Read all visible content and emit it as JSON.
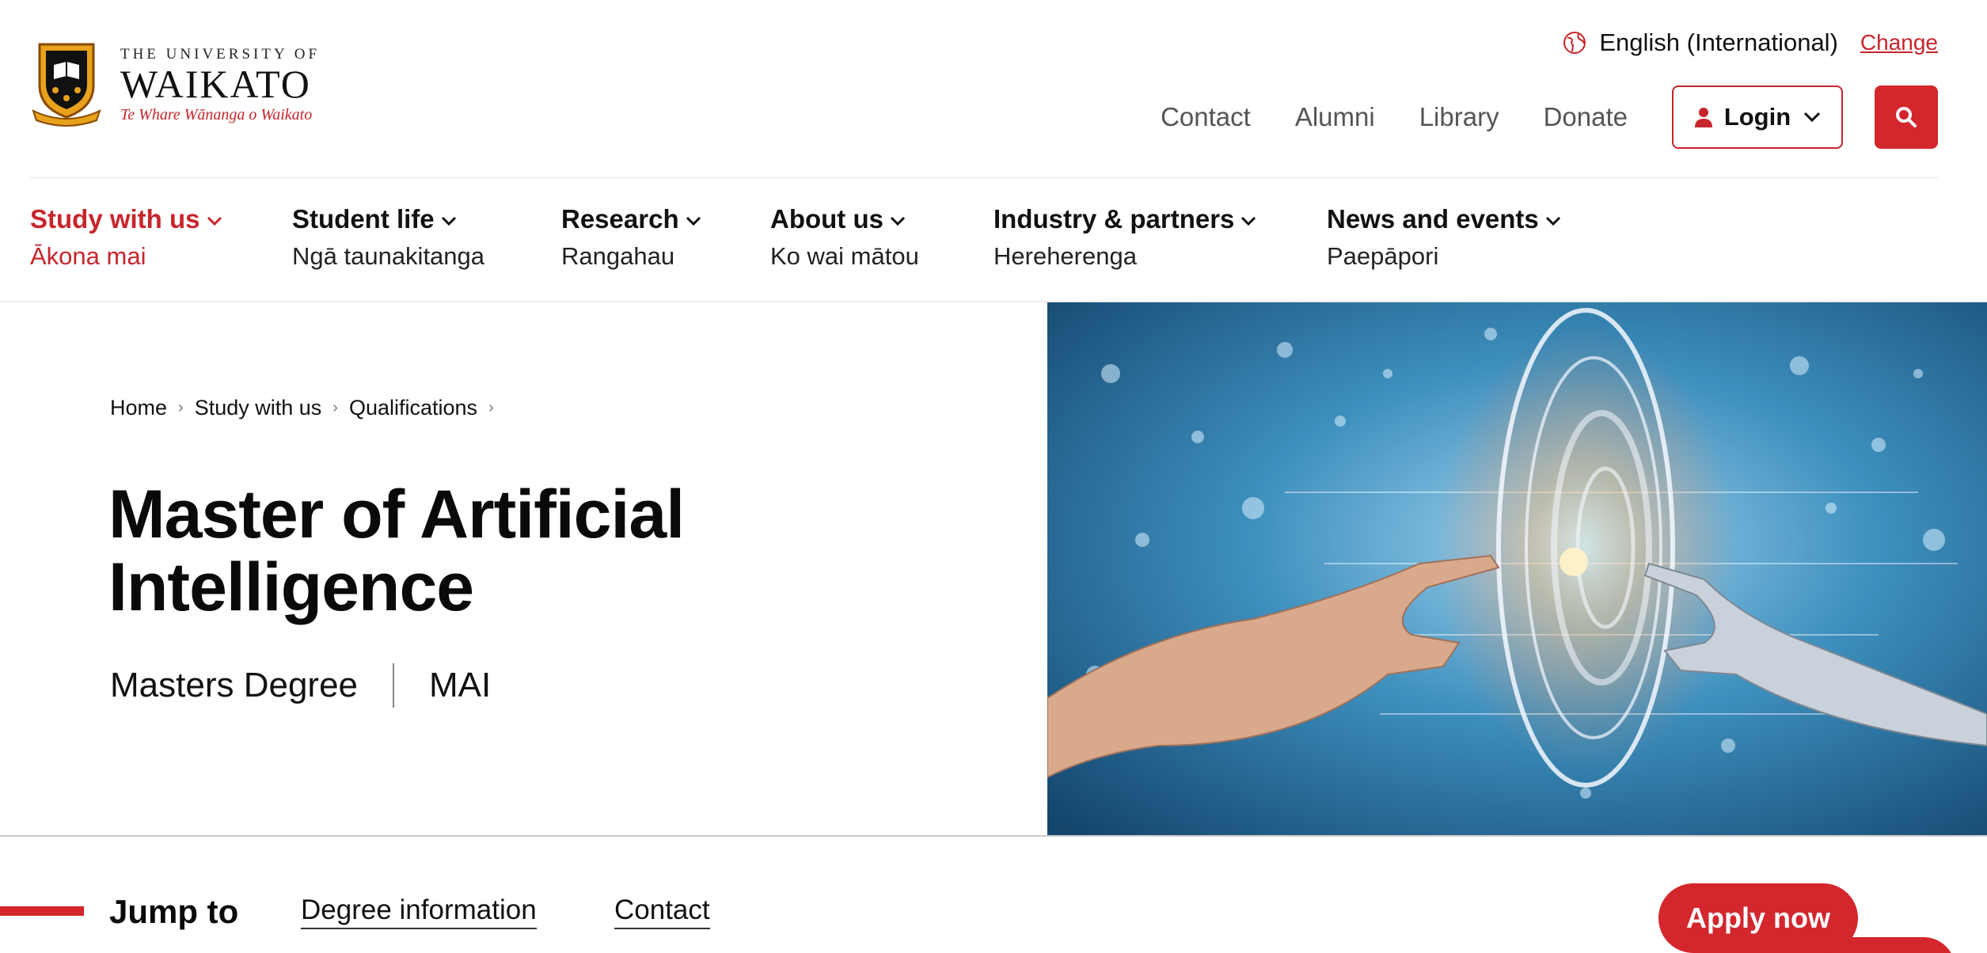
{
  "header": {
    "logo": {
      "line_small": "THE UNIVERSITY OF",
      "line_big": "WAIKATO",
      "tagline": "Te Whare Wānanga o Waikato",
      "crest_ribbon": "KO TE TANGATA"
    },
    "language": {
      "label": "English (International)",
      "change_label": "Change",
      "icon": "globe-icon"
    },
    "utility_links": [
      "Contact",
      "Alumni",
      "Library",
      "Donate"
    ],
    "login": {
      "label": "Login",
      "icon": "user-icon"
    },
    "search": {
      "icon": "search-icon"
    }
  },
  "nav": [
    {
      "title": "Study with us",
      "sub": "Ākona mai",
      "active": true
    },
    {
      "title": "Student life",
      "sub": "Ngā taunakitanga",
      "active": false
    },
    {
      "title": "Research",
      "sub": "Rangahau",
      "active": false
    },
    {
      "title": "About us",
      "sub": "Ko wai mātou",
      "active": false
    },
    {
      "title": "Industry & partners",
      "sub": "Hereherenga",
      "active": false
    },
    {
      "title": "News and events",
      "sub": "Paepāpori",
      "active": false
    }
  ],
  "breadcrumb": [
    "Home",
    "Study with us",
    "Qualifications"
  ],
  "hero": {
    "title_line1": "Master of Artificial",
    "title_line2": "Intelligence",
    "degree_type": "Masters Degree",
    "degree_code": "MAI",
    "image_subject": "human hand reaching toward robotic hand through glowing digital ring"
  },
  "jump": {
    "label": "Jump to",
    "links": [
      "Degree information",
      "Contact"
    ]
  },
  "apply": {
    "label": "Apply now"
  },
  "colors": {
    "brand_red": "#d3262d",
    "text_dark": "#111111",
    "text_muted": "#555555",
    "hero_blue": "#2a7aa8"
  }
}
